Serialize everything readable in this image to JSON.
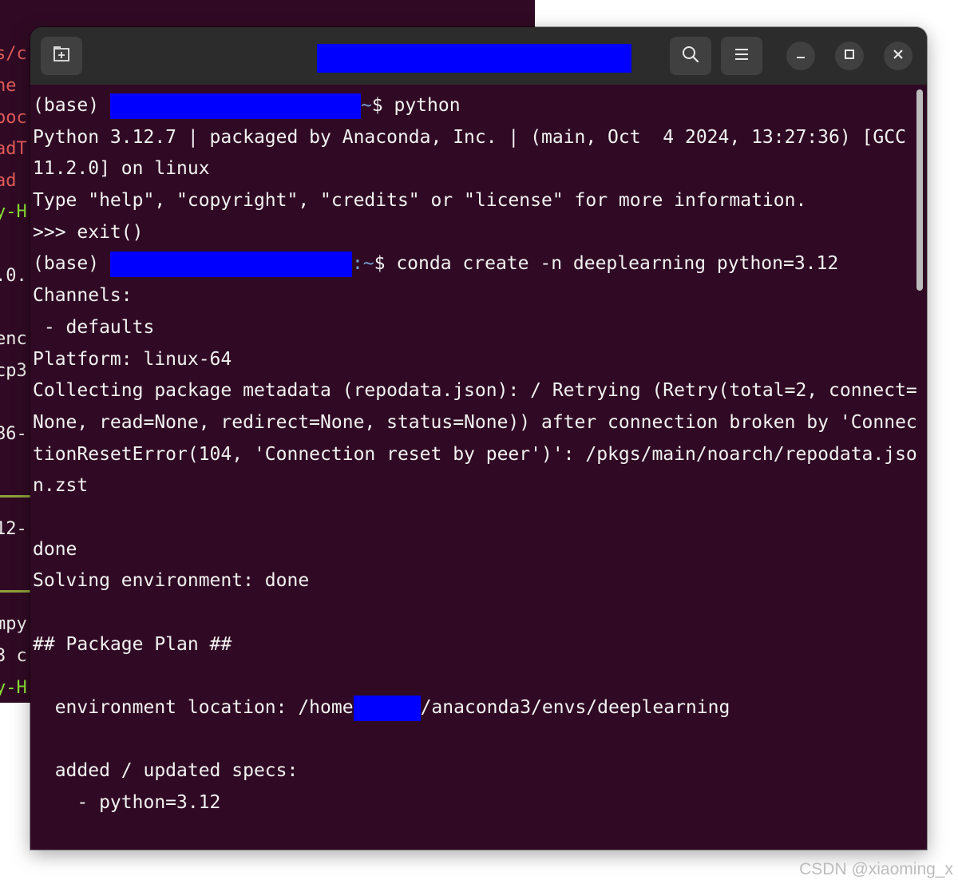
{
  "background_window": {
    "fragments": [
      {
        "text": "s/c",
        "color": "red"
      },
      {
        "text": "ne",
        "color": "red"
      },
      {
        "text": "poc",
        "color": "red"
      },
      {
        "text": "adT",
        "color": "red"
      },
      {
        "text": "ad",
        "color": "red"
      },
      {
        "text": "y-H",
        "color": "green"
      },
      {
        "text": ".0.",
        "color": "white"
      },
      {
        "text": "enc",
        "color": "white"
      },
      {
        "text": "cp3",
        "color": "white"
      },
      {
        "text": "86-",
        "color": "white"
      },
      {
        "text": "12-",
        "color": "white"
      },
      {
        "text": "mpy",
        "color": "white"
      },
      {
        "text": "3 c",
        "color": "white"
      },
      {
        "text": "y-H",
        "color": "green"
      }
    ]
  },
  "titlebar": {
    "new_tab_icon": "new-tab-icon",
    "search_icon": "search-icon",
    "menu_icon": "hamburger-menu-icon",
    "minimize_icon": "minimize-icon",
    "maximize_icon": "maximize-icon",
    "close_icon": "close-icon"
  },
  "terminal": {
    "lines": {
      "l1_prefix": "(base) ",
      "l1_path": "~",
      "l1_cmd": "$ python",
      "l2": "Python 3.12.7 | packaged by Anaconda, Inc. | (main, Oct  4 2024, 13:27:36) [GCC",
      "l3": "11.2.0] on linux",
      "l4": "Type \"help\", \"copyright\", \"credits\" or \"license\" for more information.",
      "l5": ">>> exit()",
      "l6_prefix": "(base) ",
      "l6_path": ":~",
      "l6_cmd": "$ conda create -n deeplearning python=3.12",
      "l7": "Channels:",
      "l8": " - defaults",
      "l9": "Platform: linux-64",
      "l10": "Collecting package metadata (repodata.json): / Retrying (Retry(total=2, connect=",
      "l11": "None, read=None, redirect=None, status=None)) after connection broken by 'Connec",
      "l12": "tionResetError(104, 'Connection reset by peer')': /pkgs/main/noarch/repodata.jso",
      "l13": "n.zst",
      "l14": "",
      "l15": "done",
      "l16": "Solving environment: done",
      "l17": "",
      "l18": "## Package Plan ##",
      "l19": "",
      "l20_prefix": "  environment location: /home",
      "l20_suffix": "/anaconda3/envs/deeplearning",
      "l21": "",
      "l22": "  added / updated specs:",
      "l23": "    - python=3.12"
    }
  },
  "watermark": "CSDN @xiaoming_x",
  "colors": {
    "terminal_bg": "#300a24",
    "titlebar_bg": "#2c2c2c",
    "redaction": "#0000ff",
    "path_blue": "#729fcf"
  }
}
